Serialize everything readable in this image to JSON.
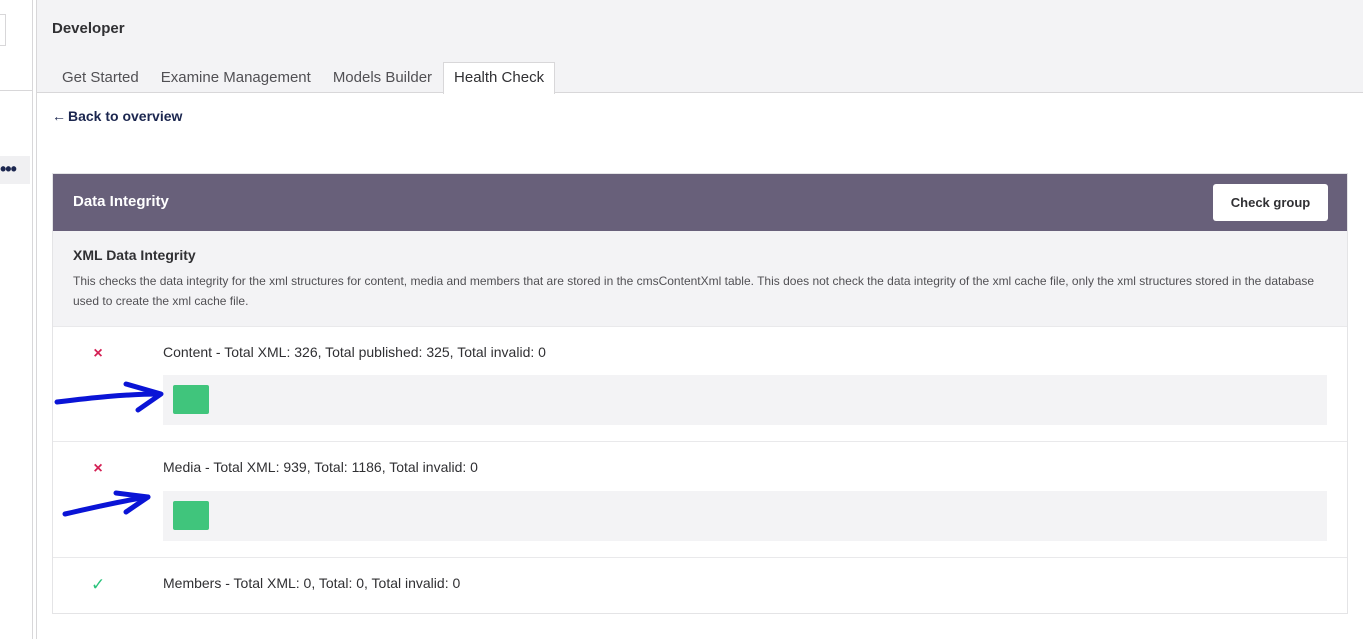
{
  "header": {
    "title": "Developer",
    "tabs": [
      {
        "label": "Get Started",
        "active": false
      },
      {
        "label": "Examine Management",
        "active": false
      },
      {
        "label": "Models Builder",
        "active": false
      },
      {
        "label": "Health Check",
        "active": true
      }
    ]
  },
  "nav": {
    "back_label": "Back to overview",
    "back_arrow": "←"
  },
  "group": {
    "title": "Data Integrity",
    "check_button_label": "Check group",
    "check": {
      "name": "XML Data Integrity",
      "description": "This checks the data integrity for the xml structures for content, media and members that are stored in the cmsContentXml table. This does not check the data integrity of the xml cache file, only the xml structures stored in the database used to create the xml cache file."
    },
    "results": [
      {
        "status": "error",
        "icon": "×",
        "text": "Content - Total XML: 326, Total published: 325, Total invalid: 0",
        "has_action": true
      },
      {
        "status": "error",
        "icon": "×",
        "text": "Media - Total XML: 939, Total: 1186, Total invalid: 0",
        "has_action": true
      },
      {
        "status": "success",
        "icon": "✓",
        "text": "Members - Total XML: 0, Total: 0, Total invalid: 0",
        "has_action": false
      }
    ]
  },
  "colors": {
    "group_header": "#68607a",
    "action_button": "#40c57c",
    "error": "#d42054",
    "success": "#2bc37c",
    "annotation_arrow": "#0a14d6"
  },
  "left_pane": {
    "more_icon": "•••"
  }
}
